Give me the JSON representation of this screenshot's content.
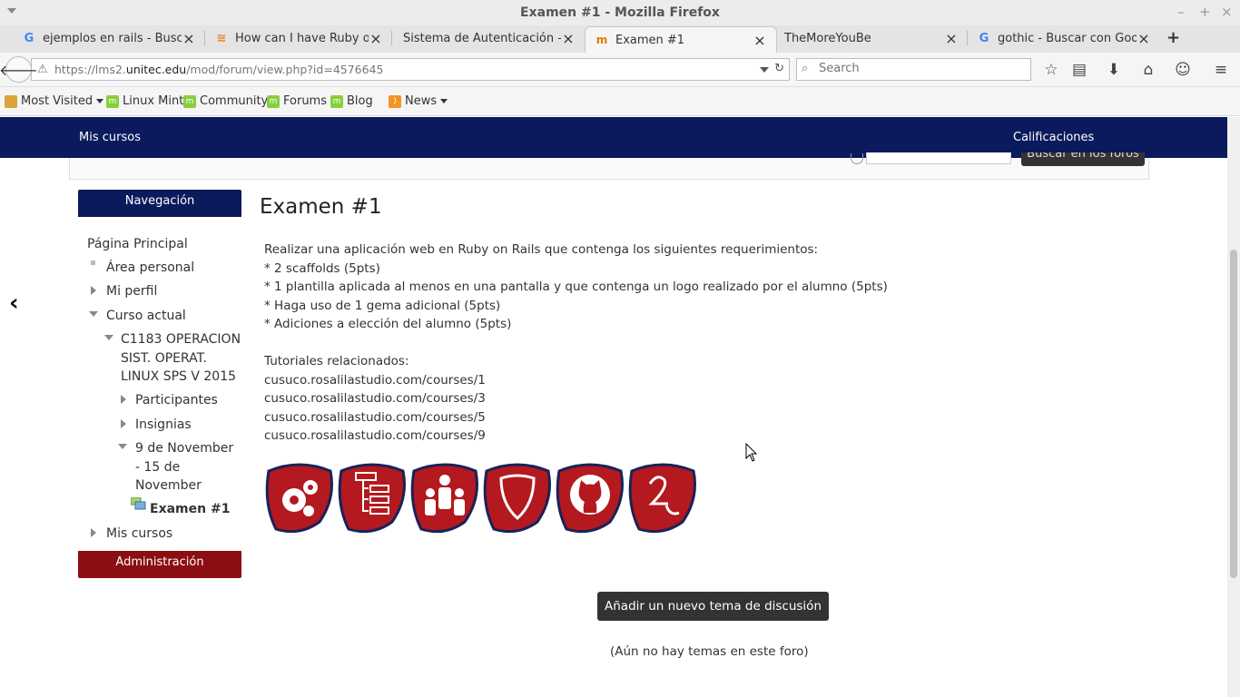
{
  "window": {
    "title": "Examen #1 - Mozilla Firefox"
  },
  "tabs": [
    {
      "label": "ejemplos en rails - Busca...",
      "icon": "google-icon"
    },
    {
      "label": "How can I have Ruby on R...",
      "icon": "stackoverflow-icon"
    },
    {
      "label": "Sistema de Autenticación - U...",
      "icon": "none"
    },
    {
      "label": "Examen #1",
      "icon": "moodle-icon",
      "active": true
    },
    {
      "label": "TheMoreYouBe",
      "icon": "none"
    },
    {
      "label": "gothic - Buscar con Google",
      "icon": "google-icon"
    }
  ],
  "navbar": {
    "url_prefix": "https://lms2.",
    "url_domain": "unitec.edu",
    "url_suffix": "/mod/forum/view.php?id=4576645",
    "search_placeholder": "Search"
  },
  "bookmarks": [
    {
      "label": "Most Visited",
      "dropdown": true
    },
    {
      "label": "Linux Mint"
    },
    {
      "label": "Community"
    },
    {
      "label": "Forums"
    },
    {
      "label": "Blog"
    },
    {
      "label": "News",
      "dropdown": true
    }
  ],
  "site": {
    "nav_left": "Mis cursos",
    "nav_right": "Calificaciones",
    "forum_search_button": "Buscar en los foros"
  },
  "navigation": {
    "header": "Navegación",
    "items": [
      "Página Principal",
      "Área personal",
      "Mi perfil",
      "Curso actual",
      "C1183 OPERACION",
      "SIST. OPERAT.",
      "LINUX SPS V 2015",
      "Participantes",
      "Insignias",
      "9 de November",
      "- 15 de",
      "November",
      "Examen #1",
      "Mis cursos"
    ],
    "admin_header": "Administración"
  },
  "main": {
    "title": "Examen #1",
    "lines": [
      "Realizar una aplicación web en Ruby on Rails que contenga los siguientes requerimientos:",
      "* 2 scaffolds (5pts)",
      "* 1 plantilla aplicada al menos en una pantalla y que contenga un logo realizado por el alumno (5pts)",
      "* Haga uso de 1 gema adicional (5pts)",
      "* Adiciones a elección del alumno (5pts)",
      "",
      "Tutoriales relacionados:",
      "cusuco.rosalilastudio.com/courses/1",
      "cusuco.rosalilastudio.com/courses/3",
      "cusuco.rosalilastudio.com/courses/5",
      "cusuco.rosalilastudio.com/courses/9"
    ],
    "badges": [
      "gears-badge-icon",
      "scaffold-badge-icon",
      "people-badge-icon",
      "shield-badge-icon",
      "github-badge-icon",
      "number-two-badge-icon"
    ],
    "add_button": "Añadir un nuevo tema de discusión",
    "empty_message": "(Aún no hay temas en este foro)"
  },
  "colors": {
    "nav_blue": "#0a1a5c",
    "admin_red": "#8b0e12",
    "badge_red": "#b3191f"
  }
}
